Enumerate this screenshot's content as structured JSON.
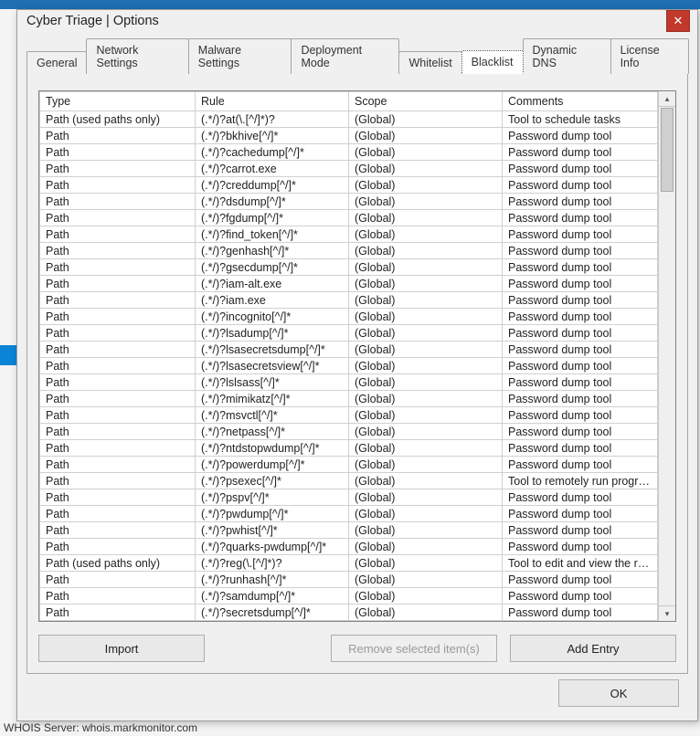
{
  "window": {
    "title": "Cyber Triage | Options"
  },
  "whois_footer": "WHOIS Server: whois.markmonitor.com",
  "tabs": [
    {
      "label": "General"
    },
    {
      "label": "Network Settings"
    },
    {
      "label": "Malware Settings"
    },
    {
      "label": "Deployment Mode"
    },
    {
      "label": "Whitelist"
    },
    {
      "label": "Blacklist",
      "selected": true
    },
    {
      "label": "Dynamic DNS"
    },
    {
      "label": "License Info"
    }
  ],
  "table": {
    "headers": {
      "type": "Type",
      "rule": "Rule",
      "scope": "Scope",
      "comments": "Comments"
    },
    "rows": [
      {
        "type": "Path (used paths only)",
        "rule": "(.*/)?at(\\.[^/]*)?",
        "scope": "(Global)",
        "comments": "Tool to schedule tasks"
      },
      {
        "type": "Path",
        "rule": "(.*/)?bkhive[^/]*",
        "scope": "(Global)",
        "comments": "Password dump tool"
      },
      {
        "type": "Path",
        "rule": "(.*/)?cachedump[^/]*",
        "scope": "(Global)",
        "comments": "Password dump tool"
      },
      {
        "type": "Path",
        "rule": "(.*/)?carrot.exe",
        "scope": "(Global)",
        "comments": "Password dump tool"
      },
      {
        "type": "Path",
        "rule": "(.*/)?creddump[^/]*",
        "scope": "(Global)",
        "comments": "Password dump tool"
      },
      {
        "type": "Path",
        "rule": "(.*/)?dsdump[^/]*",
        "scope": "(Global)",
        "comments": "Password dump tool"
      },
      {
        "type": "Path",
        "rule": "(.*/)?fgdump[^/]*",
        "scope": "(Global)",
        "comments": "Password dump tool"
      },
      {
        "type": "Path",
        "rule": "(.*/)?find_token[^/]*",
        "scope": "(Global)",
        "comments": "Password dump tool"
      },
      {
        "type": "Path",
        "rule": "(.*/)?genhash[^/]*",
        "scope": "(Global)",
        "comments": "Password dump tool"
      },
      {
        "type": "Path",
        "rule": "(.*/)?gsecdump[^/]*",
        "scope": "(Global)",
        "comments": "Password dump tool"
      },
      {
        "type": "Path",
        "rule": "(.*/)?iam-alt.exe",
        "scope": "(Global)",
        "comments": "Password dump tool"
      },
      {
        "type": "Path",
        "rule": "(.*/)?iam.exe",
        "scope": "(Global)",
        "comments": "Password dump tool"
      },
      {
        "type": "Path",
        "rule": "(.*/)?incognito[^/]*",
        "scope": "(Global)",
        "comments": "Password dump tool"
      },
      {
        "type": "Path",
        "rule": "(.*/)?lsadump[^/]*",
        "scope": "(Global)",
        "comments": "Password dump tool"
      },
      {
        "type": "Path",
        "rule": "(.*/)?lsasecretsdump[^/]*",
        "scope": "(Global)",
        "comments": "Password dump tool"
      },
      {
        "type": "Path",
        "rule": "(.*/)?lsasecretsview[^/]*",
        "scope": "(Global)",
        "comments": "Password dump tool"
      },
      {
        "type": "Path",
        "rule": "(.*/)?lslsass[^/]*",
        "scope": "(Global)",
        "comments": "Password dump tool"
      },
      {
        "type": "Path",
        "rule": "(.*/)?mimikatz[^/]*",
        "scope": "(Global)",
        "comments": "Password dump tool"
      },
      {
        "type": "Path",
        "rule": "(.*/)?msvctl[^/]*",
        "scope": "(Global)",
        "comments": "Password dump tool"
      },
      {
        "type": "Path",
        "rule": "(.*/)?netpass[^/]*",
        "scope": "(Global)",
        "comments": "Password dump tool"
      },
      {
        "type": "Path",
        "rule": "(.*/)?ntdstopwdump[^/]*",
        "scope": "(Global)",
        "comments": "Password dump tool"
      },
      {
        "type": "Path",
        "rule": "(.*/)?powerdump[^/]*",
        "scope": "(Global)",
        "comments": "Password dump tool"
      },
      {
        "type": "Path",
        "rule": "(.*/)?psexec[^/]*",
        "scope": "(Global)",
        "comments": "Tool to remotely run progra..."
      },
      {
        "type": "Path",
        "rule": "(.*/)?pspv[^/]*",
        "scope": "(Global)",
        "comments": "Password dump tool"
      },
      {
        "type": "Path",
        "rule": "(.*/)?pwdump[^/]*",
        "scope": "(Global)",
        "comments": "Password dump tool"
      },
      {
        "type": "Path",
        "rule": "(.*/)?pwhist[^/]*",
        "scope": "(Global)",
        "comments": "Password dump tool"
      },
      {
        "type": "Path",
        "rule": "(.*/)?quarks-pwdump[^/]*",
        "scope": "(Global)",
        "comments": "Password dump tool"
      },
      {
        "type": "Path (used paths only)",
        "rule": "(.*/)?reg(\\.[^/]*)?",
        "scope": "(Global)",
        "comments": "Tool to edit and view the re..."
      },
      {
        "type": "Path",
        "rule": "(.*/)?runhash[^/]*",
        "scope": "(Global)",
        "comments": "Password dump tool"
      },
      {
        "type": "Path",
        "rule": "(.*/)?samdump[^/]*",
        "scope": "(Global)",
        "comments": "Password dump tool"
      },
      {
        "type": "Path",
        "rule": "(.*/)?secretsdump[^/]*",
        "scope": "(Global)",
        "comments": "Password dump tool"
      }
    ]
  },
  "buttons": {
    "import": "Import",
    "remove": "Remove selected item(s)",
    "add": "Add Entry",
    "ok": "OK"
  }
}
